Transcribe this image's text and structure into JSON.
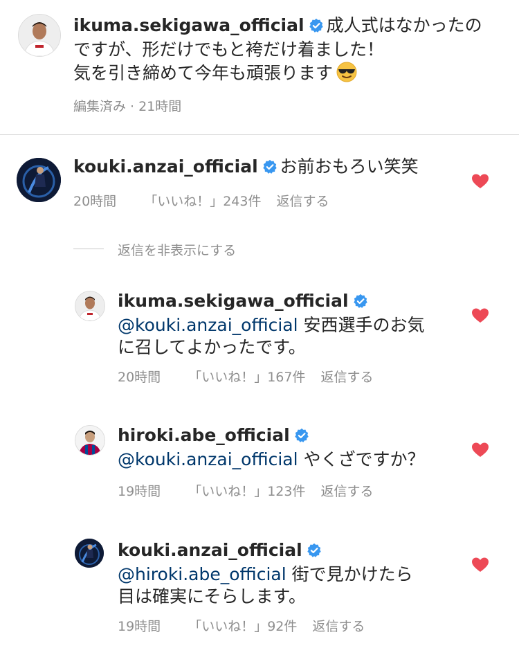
{
  "caption": {
    "username": "ikuma.sekigawa_official",
    "line1": "成人式はなかったの",
    "line2": "ですが、形だけでもと袴だけ着ました！",
    "line3": "気を引き締めて今年も頑張ります",
    "emoji": "smiling-face-with-sunglasses",
    "edited_label": "編集済み",
    "separator": "·",
    "time": "21時間"
  },
  "comments": [
    {
      "username": "kouki.anzai_official",
      "text": "お前おもろい笑笑",
      "time": "20時間",
      "likes": "「いいね！」243件",
      "reply": "返信する"
    }
  ],
  "hide_replies_label": "返信を非表示にする",
  "replies": [
    {
      "username": "ikuma.sekigawa_official",
      "mention": "@kouki.anzai_official",
      "text1": "安西選手のお気",
      "text2": "に召してよかったです。",
      "time": "20時間",
      "likes": "「いいね！」167件",
      "reply": "返信する"
    },
    {
      "username": "hiroki.abe_official",
      "mention": "@kouki.anzai_official",
      "text1": "やくざですか？",
      "time": "19時間",
      "likes": "「いいね！」123件",
      "reply": "返信する"
    },
    {
      "username": "kouki.anzai_official",
      "mention": "@hiroki.abe_official",
      "text1": "街で見かけたら",
      "text2": "目は確実にそらします。",
      "time": "19時間",
      "likes": "「いいね！」92件",
      "reply": "返信する"
    }
  ],
  "colors": {
    "verified": "#3897f0",
    "heart": "#ed4956",
    "mention": "#00376b",
    "meta": "#8e8e8e"
  }
}
